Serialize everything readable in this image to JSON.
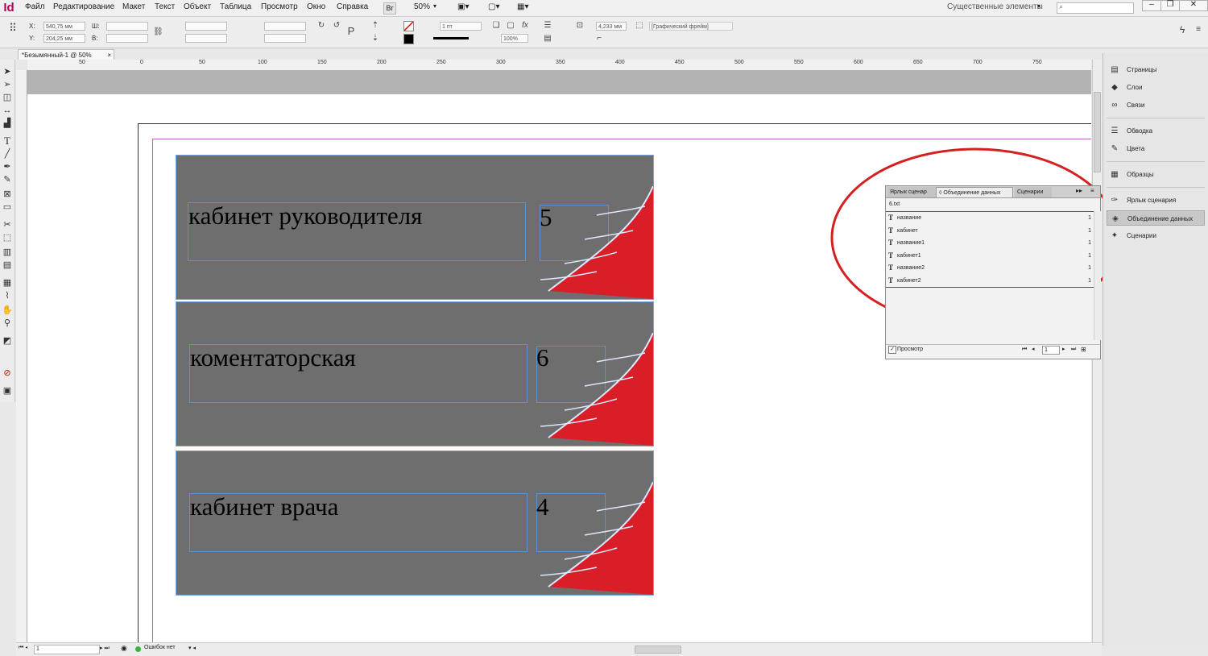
{
  "app": {
    "logo": "Id"
  },
  "menubar": {
    "items": [
      "Файл",
      "Редактирование",
      "Макет",
      "Текст",
      "Объект",
      "Таблица",
      "Просмотр",
      "Окно",
      "Справка"
    ],
    "bridge_label": "Br",
    "zoom": "50%",
    "workspace": "Существенные элементы"
  },
  "controlbar": {
    "x_label": "X:",
    "x_value": "540,75 мм",
    "y_label": "Y:",
    "y_value": "204,25 мм",
    "w_label": "Ш:",
    "h_label": "В:",
    "stroke_weight": "1 пт",
    "opacity": "100%",
    "offset": "4,233 мм",
    "object_style": "[Графический фрейм]"
  },
  "document_tab": {
    "title": "*Безымянный-1 @ 50%",
    "close": "×"
  },
  "ruler": {
    "h_ticks": [
      "50",
      "0",
      "50",
      "100",
      "150",
      "200",
      "250",
      "300",
      "350",
      "400",
      "450",
      "500",
      "550",
      "600",
      "650",
      "700",
      "750"
    ]
  },
  "cards": [
    {
      "title": "кабинет руководителя",
      "number": "5"
    },
    {
      "title": "коментаторская",
      "number": "6"
    },
    {
      "title": "кабинет врача",
      "number": "4"
    }
  ],
  "data_merge_panel": {
    "tabs": [
      "Ярлык сценар",
      "Объединение данных",
      "Сценарии"
    ],
    "file": "6.txt",
    "fields": [
      {
        "name": "название",
        "count": "1"
      },
      {
        "name": "кабинет",
        "count": "1"
      },
      {
        "name": "название1",
        "count": "1"
      },
      {
        "name": "кабинет1",
        "count": "1"
      },
      {
        "name": "название2",
        "count": "1"
      },
      {
        "name": "кабинет2",
        "count": "1"
      }
    ],
    "preview_label": "Просмотр",
    "record": "1"
  },
  "dock": {
    "items": [
      "Страницы",
      "Слои",
      "Связи",
      "Обводка",
      "Цвета",
      "Образцы",
      "Ярлык сценария",
      "Объединение данных",
      "Сценарии"
    ]
  },
  "statusbar": {
    "page": "1",
    "errors": "Ошибок нет"
  },
  "colors": {
    "accent": "#b4005a",
    "card_bg": "#6e6e6e",
    "frame": "#5f8fd0",
    "ellipse": "#d42020",
    "wing_red": "#e0202a"
  }
}
